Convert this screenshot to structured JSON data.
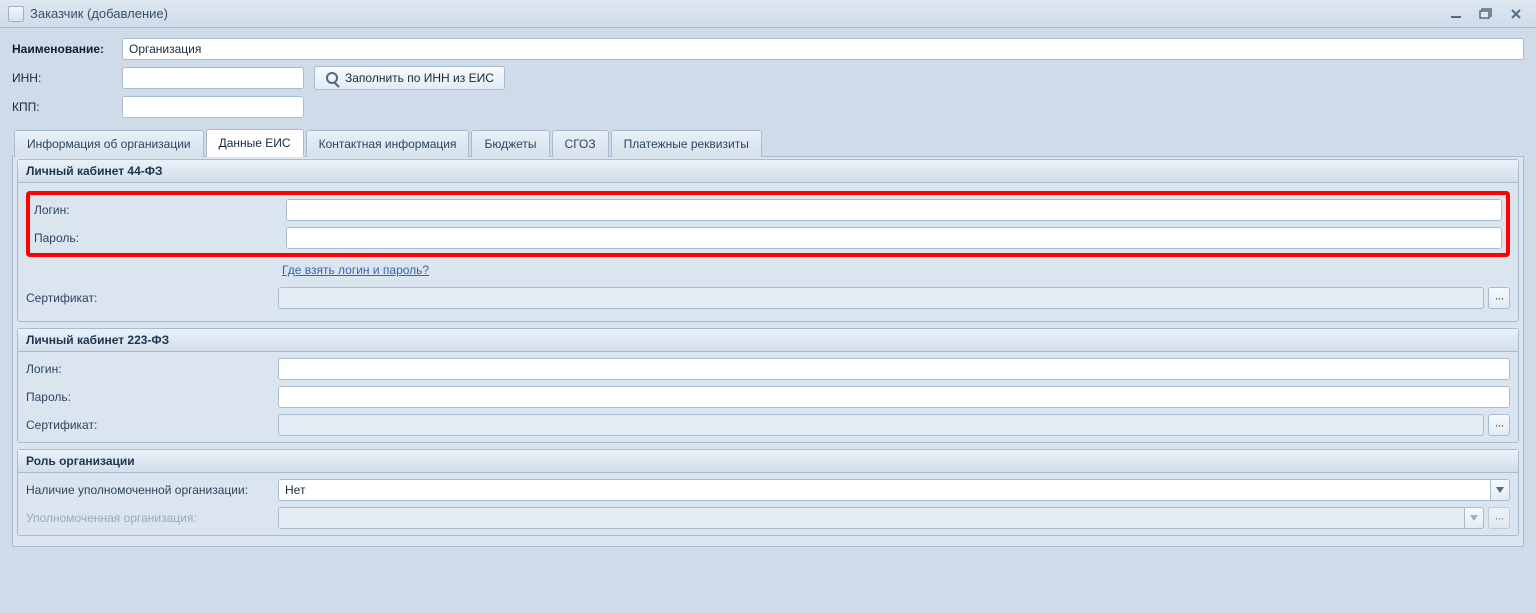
{
  "window": {
    "title": "Заказчик (добавление)"
  },
  "header": {
    "name_label": "Наименование:",
    "name_value": "Организация",
    "inn_label": "ИНН:",
    "inn_value": "",
    "kpp_label": "КПП:",
    "kpp_value": "",
    "fill_btn": "Заполнить по ИНН из ЕИС"
  },
  "tabs": {
    "items": [
      {
        "label": "Информация об организации"
      },
      {
        "label": "Данные ЕИС"
      },
      {
        "label": "Контактная информация"
      },
      {
        "label": "Бюджеты"
      },
      {
        "label": "СГОЗ"
      },
      {
        "label": "Платежные реквизиты"
      }
    ],
    "active_index": 1
  },
  "group44": {
    "title": "Личный кабинет 44-ФЗ",
    "login_label": "Логин:",
    "login_value": "",
    "password_label": "Пароль:",
    "password_value": "",
    "help_link": "Где взять логин и пароль?",
    "cert_label": "Сертификат:",
    "cert_value": "",
    "dots": "···"
  },
  "group223": {
    "title": "Личный кабинет 223-ФЗ",
    "login_label": "Логин:",
    "login_value": "",
    "password_label": "Пароль:",
    "password_value": "",
    "cert_label": "Сертификат:",
    "cert_value": "",
    "dots": "···"
  },
  "role": {
    "title": "Роль организации",
    "has_auth_label": "Наличие уполномоченной организации:",
    "has_auth_value": "Нет",
    "auth_org_label": "Уполномоченная организация:",
    "auth_org_value": "",
    "dots": "···"
  }
}
